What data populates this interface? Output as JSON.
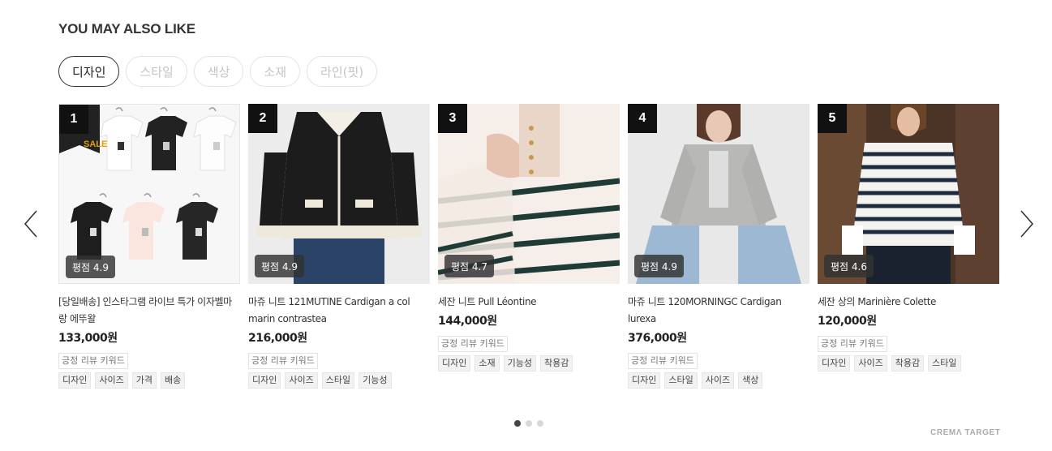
{
  "section": {
    "title": "YOU MAY ALSO LIKE"
  },
  "filters": [
    {
      "label": "디자인",
      "active": true
    },
    {
      "label": "스타일",
      "active": false
    },
    {
      "label": "색상",
      "active": false
    },
    {
      "label": "소재",
      "active": false
    },
    {
      "label": "라인(핏)",
      "active": false
    }
  ],
  "carousel": {
    "prev_icon": "chevron-left-icon",
    "next_icon": "chevron-right-icon",
    "page_count": 3,
    "current_page": 1
  },
  "products": [
    {
      "rank": "1",
      "rating": "평점 4.9",
      "name": "[당일배송] 인스타그램 라이브 특가 이자벨마랑 에뚜왈",
      "price": "133,000원",
      "keyword_title": "긍정 리뷰 키워드",
      "keywords": [
        "디자인",
        "사이즈",
        "가격",
        "배송"
      ],
      "thumb_badge": "SALE"
    },
    {
      "rank": "2",
      "rating": "평점 4.9",
      "name": "마쥬 니트 121MUTINE Cardigan a col marin contrastea",
      "price": "216,000원",
      "keyword_title": "긍정 리뷰 키워드",
      "keywords": [
        "디자인",
        "사이즈",
        "스타일",
        "기능성"
      ]
    },
    {
      "rank": "3",
      "rating": "평점 4.7",
      "name": "세잔 니트 Pull Léontine",
      "price": "144,000원",
      "keyword_title": "긍정 리뷰 키워드",
      "keywords": [
        "디자인",
        "소재",
        "기능성",
        "착용감"
      ]
    },
    {
      "rank": "4",
      "rating": "평점 4.9",
      "name": "마쥬 니트 120MORNINGC Cardigan lurexa",
      "price": "376,000원",
      "keyword_title": "긍정 리뷰 키워드",
      "keywords": [
        "디자인",
        "스타일",
        "사이즈",
        "색상"
      ]
    },
    {
      "rank": "5",
      "rating": "평점 4.6",
      "name": "세잔 상의 Marinière Colette",
      "price": "120,000원",
      "keyword_title": "긍정 리뷰 키워드",
      "keywords": [
        "디자인",
        "사이즈",
        "착용감",
        "스타일"
      ]
    }
  ],
  "footer": {
    "brand": "CREMΛ TARGET"
  },
  "colors": {
    "accent": "#111111",
    "rating_bg": "#323232",
    "chip_bg": "#f2f2f2"
  }
}
